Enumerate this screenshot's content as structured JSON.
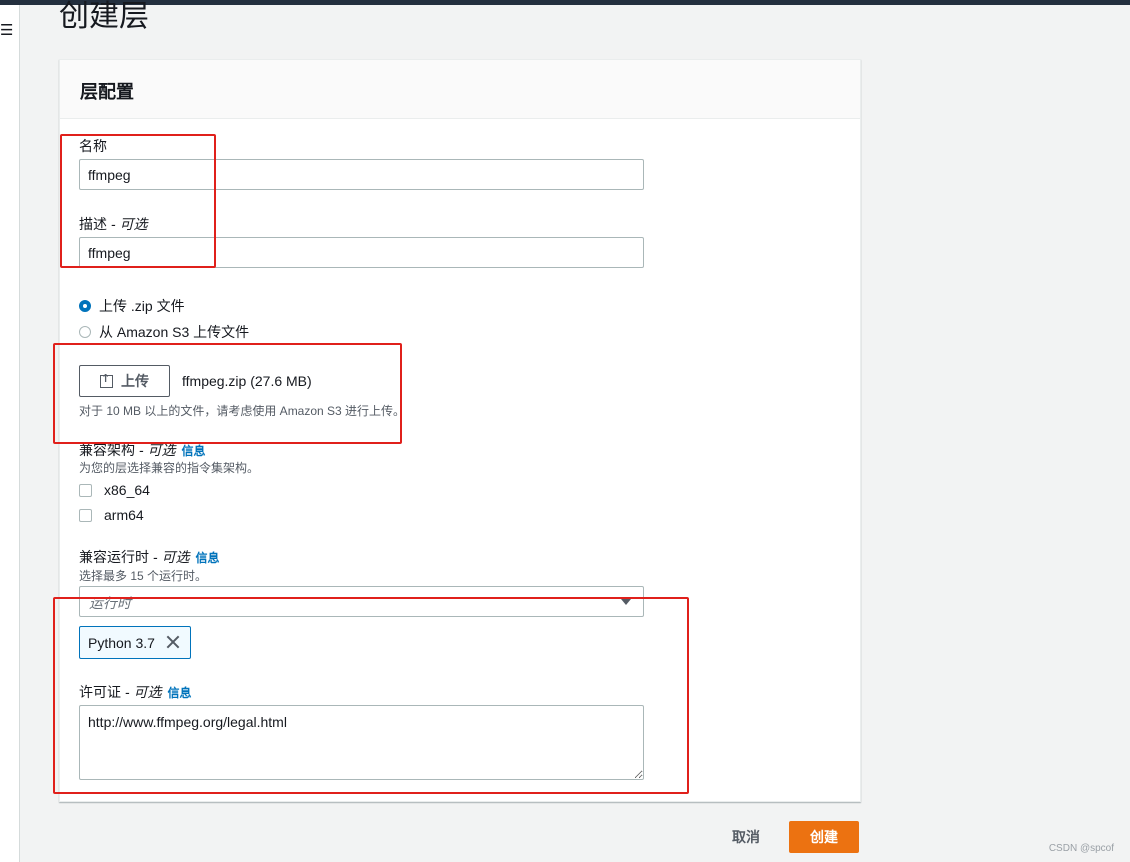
{
  "page": {
    "title": "创建层"
  },
  "card": {
    "title": "层配置"
  },
  "name_field": {
    "label": "名称",
    "value": "ffmpeg"
  },
  "desc_field": {
    "label": "描述",
    "optional": " - 可选",
    "value": "ffmpeg"
  },
  "source": {
    "options": [
      {
        "label": "上传 .zip 文件",
        "selected": true
      },
      {
        "label": "从 Amazon S3 上传文件",
        "selected": false
      }
    ]
  },
  "upload": {
    "button_label": "上传",
    "file_name": "ffmpeg.zip (27.6 MB)",
    "hint": "对于 10 MB 以上的文件，请考虑使用 Amazon S3 进行上传。"
  },
  "architectures": {
    "label": "兼容架构",
    "optional": " - 可选",
    "info": "信息",
    "hint": "为您的层选择兼容的指令集架构。",
    "options": [
      {
        "label": "x86_64",
        "checked": false
      },
      {
        "label": "arm64",
        "checked": false
      }
    ]
  },
  "runtimes": {
    "label": "兼容运行时",
    "optional": " - 可选",
    "info": "信息",
    "hint": "选择最多 15 个运行时。",
    "placeholder": "运行时",
    "selected": [
      "Python 3.7"
    ]
  },
  "license": {
    "label": "许可证",
    "optional": " - 可选",
    "info": "信息",
    "value": "http://www.ffmpeg.org/legal.html"
  },
  "actions": {
    "cancel": "取消",
    "create": "创建"
  },
  "watermark": "CSDN @spcof",
  "colors": {
    "primary": "#ec7211",
    "link": "#0073bb",
    "annotation": "#e0201b"
  }
}
